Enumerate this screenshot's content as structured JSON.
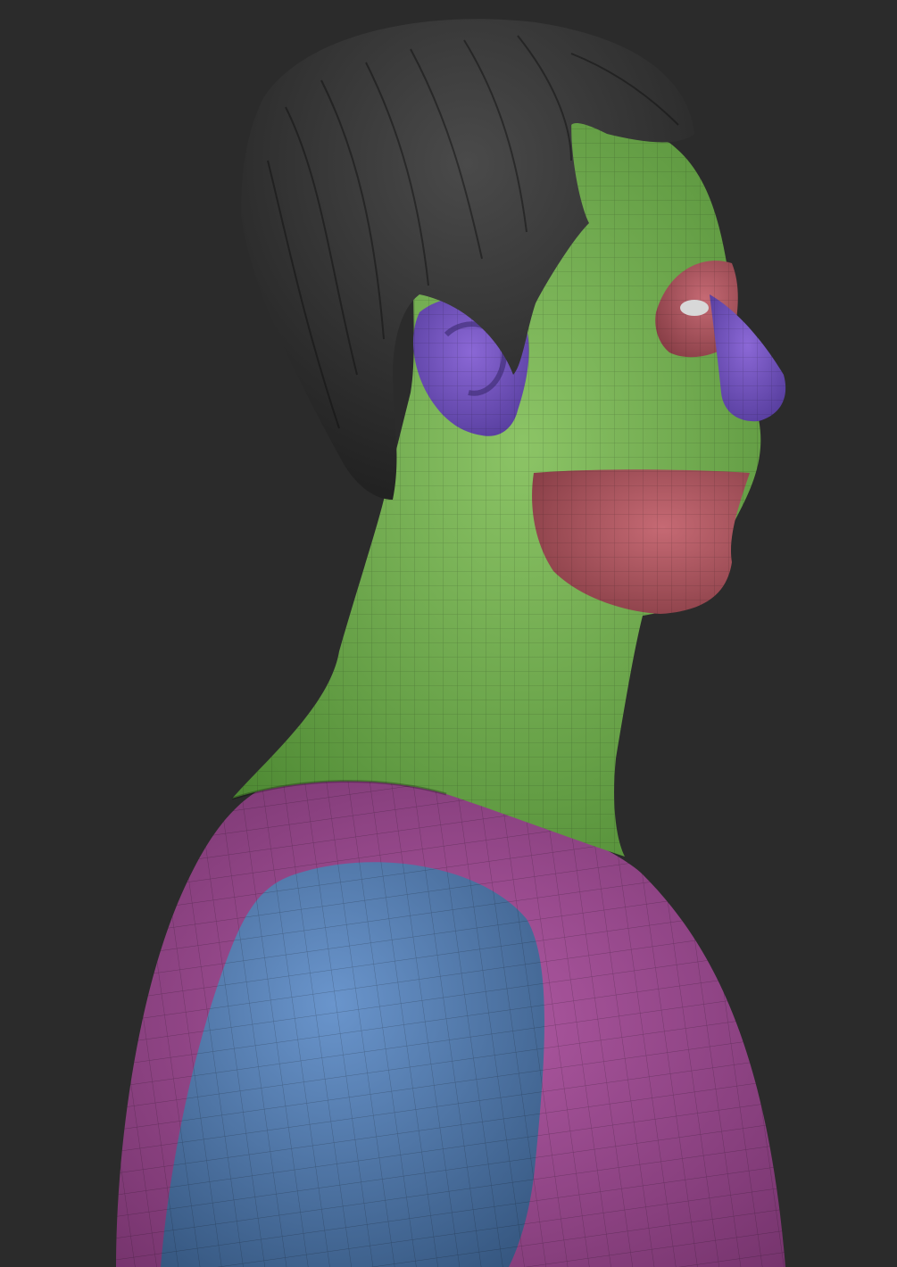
{
  "scene": {
    "background": "#2b2b2b",
    "subject": "sculpted-male-bust-profile",
    "polygroups": {
      "hair": "#3a3a3a",
      "face_neck": "#6ea84a",
      "eye_region": "#a8505a",
      "nose": "#6a4fb8",
      "ear": "#7a55c0",
      "jaw_chin": "#b0545e",
      "chest_shoulder": "#9a4a8e",
      "upper_arm": "#4f78b0"
    },
    "wireframe": "#1f2a1a"
  }
}
